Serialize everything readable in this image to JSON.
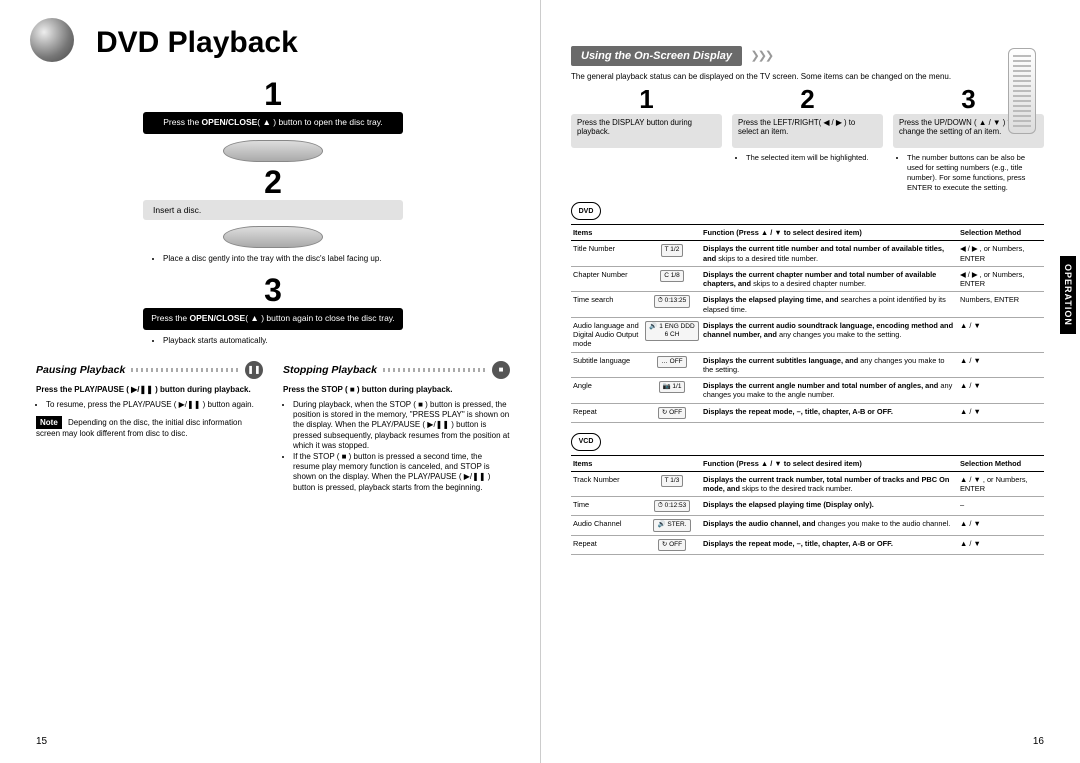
{
  "left": {
    "title": "DVD Playback",
    "step1": {
      "num": "1",
      "text_pre": "Press the ",
      "btn": "OPEN/CLOSE",
      "icon": "( ▲ )",
      "text_post": " button to open the disc tray."
    },
    "step2": {
      "num": "2",
      "text": "Insert a disc.",
      "bullet": "Place a disc gently into the tray with the disc's label facing up."
    },
    "step3": {
      "num": "3",
      "text_pre": "Press the ",
      "btn": "OPEN/CLOSE",
      "icon": "( ▲ )",
      "text_post": " button again to close the disc tray.",
      "bullet": "Playback starts automatically."
    },
    "pausing": {
      "heading": "Pausing Playback",
      "icon": "❚❚",
      "line1": "Press the PLAY/PAUSE ( ▶/❚❚ ) button during playback.",
      "bullet": "To resume, press the PLAY/PAUSE ( ▶/❚❚ ) button again.",
      "note_label": "Note",
      "note": "Depending on the disc, the initial disc information screen may look different from disc to disc."
    },
    "stopping": {
      "heading": "Stopping Playback",
      "icon": "■",
      "line1": "Press the STOP ( ■ ) button during playback.",
      "b1": "During playback, when the STOP ( ■ ) button is pressed, the position is stored in the memory, \"PRESS PLAY\" is shown on the display. When the PLAY/PAUSE ( ▶/❚❚ ) button is pressed subsequently, playback resumes from the position at which it was stopped.",
      "b2": "If the STOP ( ■ ) button is pressed a second time, the resume play memory function is canceled, and STOP is shown on the display. When the PLAY/PAUSE ( ▶/❚❚ ) button is pressed, playback starts from the beginning."
    },
    "pagenum": "15"
  },
  "right": {
    "section_title": "Using the On-Screen Display",
    "intro": "The general playback status can be displayed on the TV screen. Some items can be changed on the menu.",
    "steps": [
      {
        "num": "1",
        "text": "Press the DISPLAY button during playback."
      },
      {
        "num": "2",
        "text": "Press the LEFT/RIGHT( ◀ / ▶ ) to select an item.",
        "bullet": "The selected item will be highlighted."
      },
      {
        "num": "3",
        "text": "Press the UP/DOWN ( ▲ / ▼ ) to change the setting of an item.",
        "bullet": "The number buttons can be also be used for setting numbers (e.g., title number). For some functions, press ENTER to execute the setting."
      }
    ],
    "badge_dvd": "DVD",
    "badge_vcd": "VCD",
    "headers": {
      "items": "Items",
      "func": "Function (Press ▲ / ▼ to select desired item)",
      "sel": "Selection Method"
    },
    "dvd_rows": [
      {
        "item": "Title Number",
        "icon": "T  1/2",
        "func": "<b>Displays the current title number and total number of available titles, and</b> skips to a desired title number.",
        "sel": "◀ / ▶ , or Numbers, ENTER"
      },
      {
        "item": "Chapter Number",
        "icon": "C  1/8",
        "func": "<b>Displays the current chapter number and total number of available chapters, and</b> skips to a desired chapter number.",
        "sel": "◀ / ▶ , or Numbers, ENTER"
      },
      {
        "item": "Time search",
        "icon": "⏱ 0:13:25",
        "func": "<b>Displays the elapsed playing time, and</b> searches a point identified by its elapsed time.",
        "sel": "Numbers, ENTER"
      },
      {
        "item": "Audio language and Digital Audio Output mode",
        "icon": "🔊 1 ENG DDD 6 CH",
        "func": "<b>Displays the current audio soundtrack language, encoding method and channel number, and</b> any changes you make to the setting.",
        "sel": "▲ / ▼"
      },
      {
        "item": "Subtitle language",
        "icon": "… OFF",
        "func": "<b>Displays the current subtitles language, and</b> any changes you make to the setting.",
        "sel": "▲ / ▼"
      },
      {
        "item": "Angle",
        "icon": "📷 1/1",
        "func": "<b>Displays the current angle number and total number of angles, and</b> any changes you make to the angle number.",
        "sel": "▲ / ▼"
      },
      {
        "item": "Repeat",
        "icon": "↻ OFF",
        "func": "<b>Displays the repeat mode, –, title, chapter, A-B or OFF.</b>",
        "sel": "▲ / ▼"
      }
    ],
    "vcd_rows": [
      {
        "item": "Track Number",
        "icon": "T  1/3",
        "func": "<b>Displays the current track number, total number of tracks and PBC On mode, and</b> skips to the desired track number.",
        "sel": "▲ / ▼ , or Numbers, ENTER"
      },
      {
        "item": "Time",
        "icon": "⏱ 0:12:53",
        "func": "<b>Displays the elapsed playing time (Display only).</b>",
        "sel": "–"
      },
      {
        "item": "Audio Channel",
        "icon": "🔊 STER.",
        "func": "<b>Displays the audio channel, and</b> changes you make to the audio channel.",
        "sel": "▲ / ▼"
      },
      {
        "item": "Repeat",
        "icon": "↻ OFF",
        "func": "<b>Displays the repeat mode, –, title, chapter, A-B or OFF.</b>",
        "sel": "▲ / ▼"
      }
    ],
    "side_tab": "OPERATION",
    "pagenum": "16"
  }
}
